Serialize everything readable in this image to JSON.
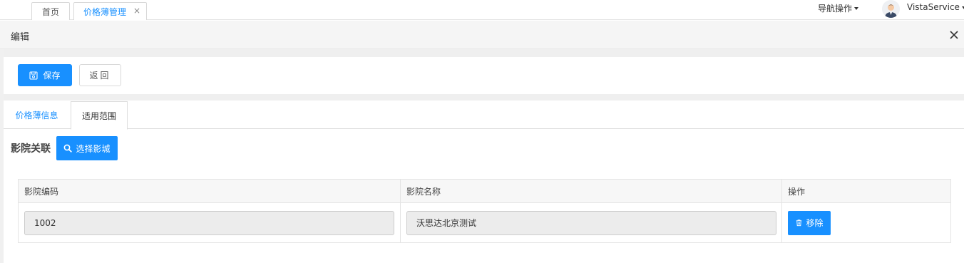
{
  "top_tabs": [
    {
      "label": "首页"
    },
    {
      "label": "价格薄管理",
      "close": "×"
    }
  ],
  "header_right": {
    "nav_ops_label": "导航操作",
    "user_name": "VistaService"
  },
  "edit": {
    "title": "编辑"
  },
  "toolbar": {
    "save_label": "保存",
    "back_label": "返回"
  },
  "content_tabs": [
    {
      "label": "价格薄信息"
    },
    {
      "label": "适用范围"
    }
  ],
  "section": {
    "title": "影院关联",
    "select_button_label": "选择影城"
  },
  "table": {
    "headers": [
      "影院编码",
      "影院名称",
      "操作"
    ],
    "rows": [
      {
        "code": "1002",
        "name": "沃思达北京测试",
        "action_label": "移除"
      }
    ]
  },
  "colors": {
    "primary": "#1890ff",
    "readonly_field_bg": "#ececec"
  }
}
